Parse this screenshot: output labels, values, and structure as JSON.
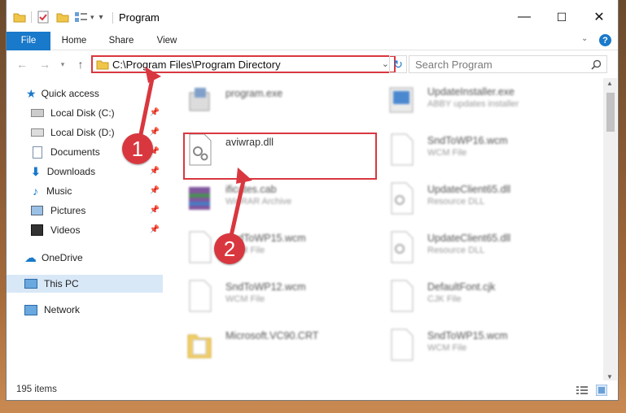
{
  "window": {
    "title": "Program",
    "minimize_glyph": "—",
    "maximize_glyph": "☐",
    "close_glyph": "✕"
  },
  "ribbon": {
    "tabs": [
      {
        "label": "File"
      },
      {
        "label": "Home"
      },
      {
        "label": "Share"
      },
      {
        "label": "View"
      }
    ],
    "help_glyph": "?"
  },
  "address_bar": {
    "path": "C:\\Program Files\\Program Directory"
  },
  "search": {
    "placeholder": "Search Program"
  },
  "sidebar": {
    "quick_access": "Quick access",
    "items": [
      {
        "label": "Local Disk (C:)"
      },
      {
        "label": "Local Disk (D:)"
      },
      {
        "label": "Documents"
      },
      {
        "label": "Downloads"
      },
      {
        "label": "Music"
      },
      {
        "label": "Pictures"
      },
      {
        "label": "Videos"
      }
    ],
    "onedrive": "OneDrive",
    "this_pc": "This PC",
    "network": "Network"
  },
  "files": {
    "left": [
      {
        "name": "program.exe",
        "type": ""
      },
      {
        "name": "aviwrap.dll",
        "type": ""
      },
      {
        "name": "ificates.cab",
        "type": "WinRAR Archive"
      },
      {
        "name": "SndToWP15.wcm",
        "type": "WCM File"
      },
      {
        "name": "SndToWP12.wcm",
        "type": "WCM File"
      },
      {
        "name": "Microsoft.VC90.CRT",
        "type": ""
      }
    ],
    "right": [
      {
        "name": "UpdateInstaller.exe",
        "type": "ABBY updates installer"
      },
      {
        "name": "SndToWP16.wcm",
        "type": "WCM File"
      },
      {
        "name": "UpdateClient65.dll",
        "type": "Resource DLL"
      },
      {
        "name": "UpdateClient65.dll",
        "type": "Resource DLL"
      },
      {
        "name": "DefaultFont.cjk",
        "type": "CJK File"
      },
      {
        "name": "SndToWP15.wcm",
        "type": "WCM File"
      }
    ]
  },
  "status": {
    "item_count": "195 items"
  },
  "callouts": {
    "one": "1",
    "two": "2"
  },
  "colors": {
    "accent": "#1979ca",
    "highlight": "#d9373f",
    "selected": "#d9e8f7"
  }
}
